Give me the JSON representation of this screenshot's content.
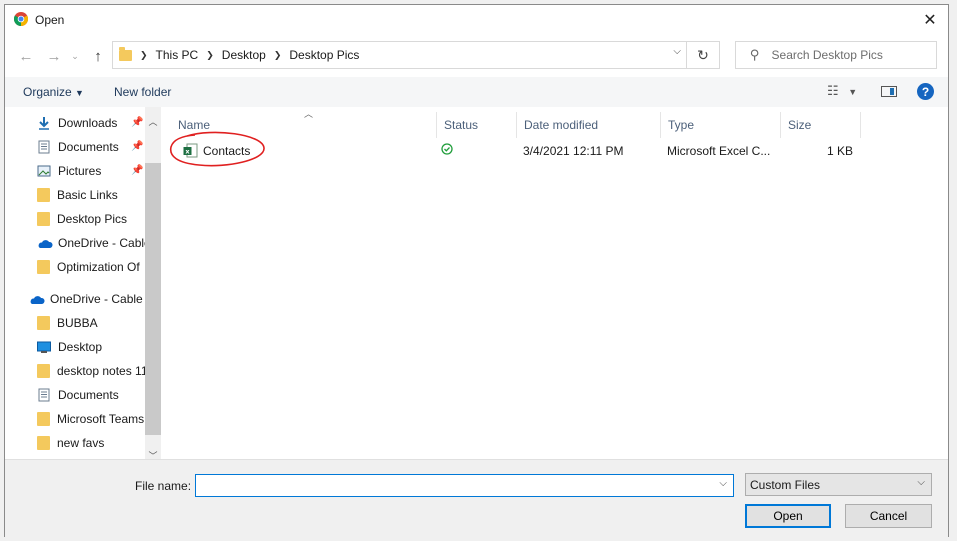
{
  "window": {
    "title": "Open"
  },
  "address": {
    "crumbs": [
      "This PC",
      "Desktop",
      "Desktop Pics"
    ]
  },
  "search": {
    "placeholder": "Search Desktop Pics"
  },
  "toolbar": {
    "organize": "Organize",
    "new_folder": "New folder"
  },
  "sidebar": {
    "items": [
      {
        "label": "Downloads",
        "icon": "download-arrow-icon",
        "pinned": true
      },
      {
        "label": "Documents",
        "icon": "document-icon",
        "pinned": true
      },
      {
        "label": "Pictures",
        "icon": "pictures-icon",
        "pinned": true
      },
      {
        "label": "Basic Links",
        "icon": "folder-icon"
      },
      {
        "label": "Desktop Pics",
        "icon": "folder-icon"
      },
      {
        "label": "OneDrive - Cable",
        "icon": "onedrive-cloud-icon"
      },
      {
        "label": "Optimization Of",
        "icon": "folder-icon"
      },
      {
        "label": "OneDrive - Cable",
        "icon": "onedrive-cloud-icon"
      },
      {
        "label": "BUBBA",
        "icon": "folder-icon"
      },
      {
        "label": "Desktop",
        "icon": "desktop-icon"
      },
      {
        "label": "desktop notes 11",
        "icon": "folder-icon"
      },
      {
        "label": "Documents",
        "icon": "document-icon"
      },
      {
        "label": "Microsoft Teams",
        "icon": "folder-icon"
      },
      {
        "label": "new favs",
        "icon": "folder-icon"
      }
    ]
  },
  "columns": {
    "name": "Name",
    "status": "Status",
    "date": "Date modified",
    "type": "Type",
    "size": "Size"
  },
  "files": [
    {
      "name": "Contacts",
      "status": "synced-check-icon",
      "date": "3/4/2021 12:11 PM",
      "type": "Microsoft Excel C...",
      "size": "1 KB"
    }
  ],
  "footer": {
    "file_name_label": "File name:",
    "file_name_value": "",
    "filter": "Custom Files",
    "open": "Open",
    "cancel": "Cancel"
  },
  "colors": {
    "accent": "#0078d7",
    "folder": "#f4c95d",
    "annotation": "#e02020"
  }
}
